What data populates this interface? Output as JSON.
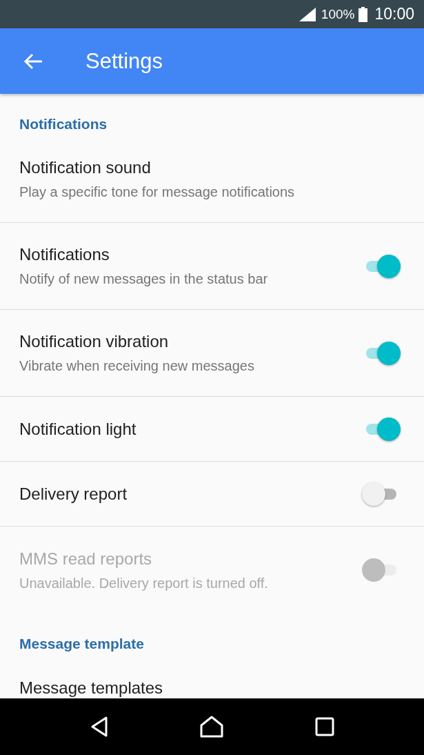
{
  "status_bar": {
    "battery": "100%",
    "time": "10:00"
  },
  "app_bar": {
    "title": "Settings"
  },
  "sections": [
    {
      "title": "Notifications",
      "items": [
        {
          "kind": "plain",
          "title": "Notification sound",
          "subtitle": "Play a specific tone for message notifications",
          "disabled": false
        },
        {
          "kind": "toggle",
          "title": "Notifications",
          "subtitle": "Notify of new messages in the status bar",
          "on": true,
          "disabled": false
        },
        {
          "kind": "toggle",
          "title": "Notification vibration",
          "subtitle": "Vibrate when receiving new messages",
          "on": true,
          "disabled": false
        },
        {
          "kind": "toggle",
          "title": "Notification light",
          "on": true,
          "disabled": false
        },
        {
          "kind": "toggle",
          "title": "Delivery report",
          "on": false,
          "disabled": false
        },
        {
          "kind": "toggle",
          "title": "MMS read reports",
          "subtitle": "Unavailable. Delivery report is turned off.",
          "on": false,
          "disabled": true
        }
      ]
    },
    {
      "title": "Message template",
      "items": [
        {
          "kind": "plain",
          "title": "Message templates",
          "disabled": false
        }
      ]
    }
  ]
}
